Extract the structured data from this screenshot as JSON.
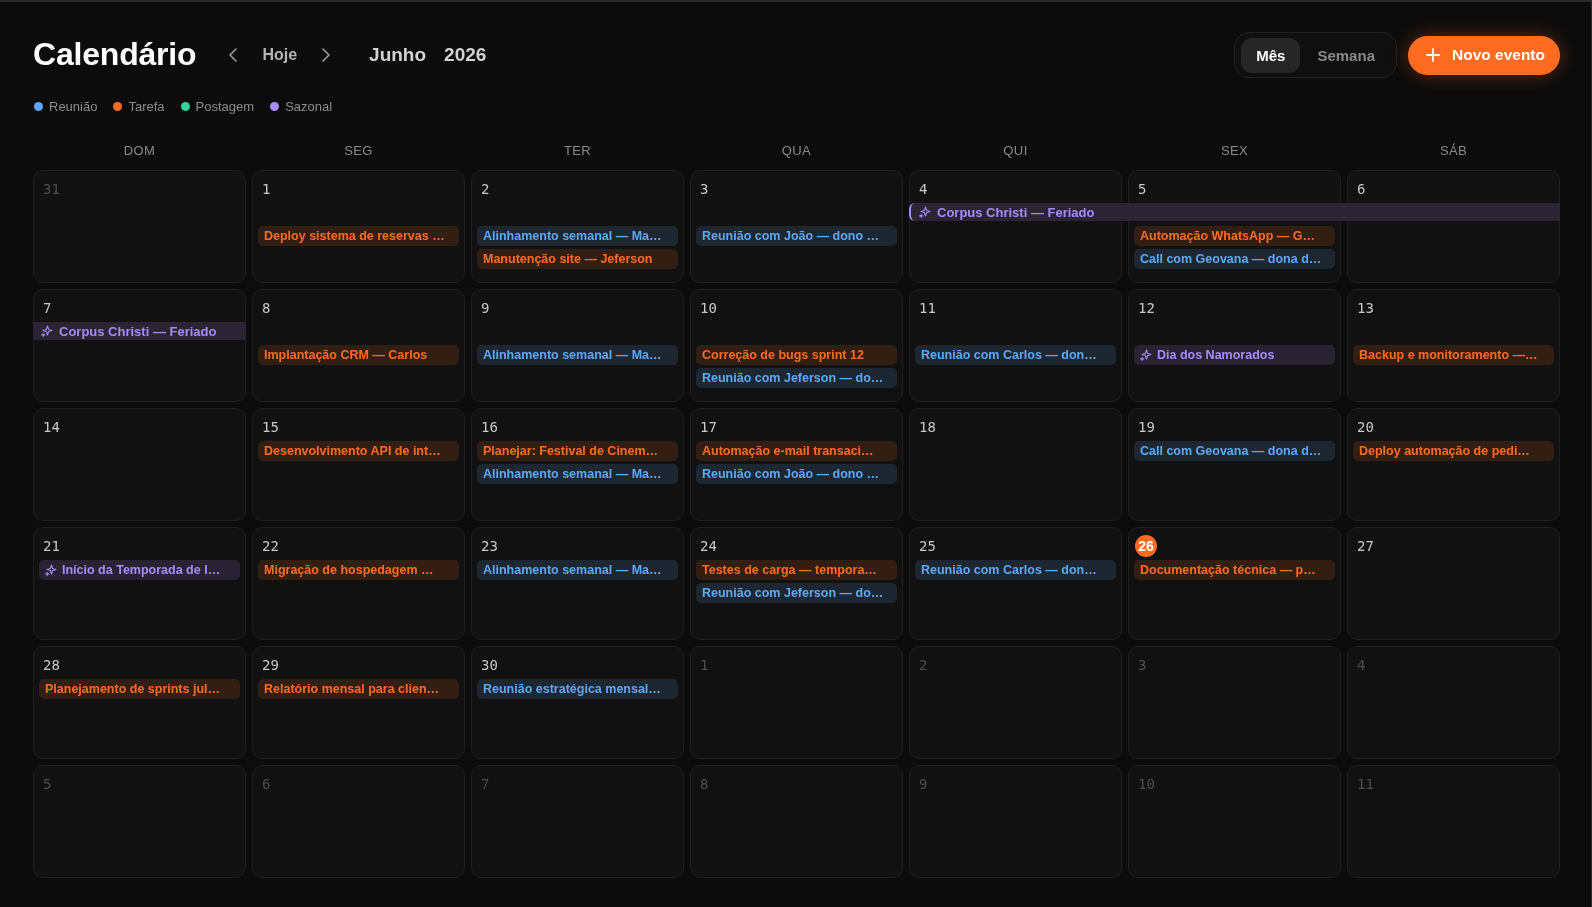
{
  "header": {
    "title": "Calendário",
    "today_button": "Hoje",
    "month": "Junho",
    "year": "2026",
    "view_tabs": [
      {
        "label": "Mês",
        "selected": true
      },
      {
        "label": "Semana",
        "selected": false
      }
    ],
    "new_event_button": "Novo evento"
  },
  "legend": [
    {
      "label": "Reunião",
      "color": "#5ea8f8"
    },
    {
      "label": "Tarefa",
      "color": "#ff6b21"
    },
    {
      "label": "Postagem",
      "color": "#34d39a"
    },
    {
      "label": "Sazonal",
      "color": "#a78bfa"
    }
  ],
  "weekdays": [
    "DOM",
    "SEG",
    "TER",
    "QUA",
    "QUI",
    "SEX",
    "SÁB"
  ],
  "weeks": [
    {
      "days": [
        {
          "number": "31",
          "in_month": false,
          "today": false
        },
        {
          "number": "1",
          "in_month": true,
          "today": false,
          "events": [
            {
              "label": "Deploy sistema de reservas …",
              "kind": "task"
            }
          ]
        },
        {
          "number": "2",
          "in_month": true,
          "today": false,
          "events": [
            {
              "label": "Alinhamento semanal — Ma…",
              "kind": "meeting"
            },
            {
              "label": "Manutenção site — Jeferson",
              "kind": "task"
            }
          ]
        },
        {
          "number": "3",
          "in_month": true,
          "today": false,
          "events": [
            {
              "label": "Reunião com João — dono …",
              "kind": "meeting"
            }
          ]
        },
        {
          "number": "4",
          "in_month": true,
          "today": false,
          "banner": {
            "label": "Corpus Christi — Feriado",
            "kind": "seasonal",
            "continued": false
          }
        },
        {
          "number": "5",
          "in_month": true,
          "today": false,
          "banner_continues": true,
          "events": [
            {
              "label": "Automação WhatsApp — G…",
              "kind": "task"
            },
            {
              "label": "Call com Geovana — dona d…",
              "kind": "meeting"
            }
          ]
        },
        {
          "number": "6",
          "in_month": true,
          "today": false,
          "banner_continues": true
        }
      ]
    },
    {
      "days": [
        {
          "number": "7",
          "in_month": true,
          "today": false,
          "banner": {
            "label": "Corpus Christi — Feriado",
            "kind": "seasonal",
            "continued": true
          }
        },
        {
          "number": "8",
          "in_month": true,
          "today": false,
          "events": [
            {
              "label": "Implantação CRM — Carlos",
              "kind": "task"
            }
          ]
        },
        {
          "number": "9",
          "in_month": true,
          "today": false,
          "events": [
            {
              "label": "Alinhamento semanal — Ma…",
              "kind": "meeting"
            }
          ]
        },
        {
          "number": "10",
          "in_month": true,
          "today": false,
          "events": [
            {
              "label": "Correção de bugs sprint 12",
              "kind": "task"
            },
            {
              "label": "Reunião com Jeferson — do…",
              "kind": "meeting"
            }
          ]
        },
        {
          "number": "11",
          "in_month": true,
          "today": false,
          "events": [
            {
              "label": "Reunião com Carlos — don…",
              "kind": "meeting"
            }
          ]
        },
        {
          "number": "12",
          "in_month": true,
          "today": false,
          "events": [
            {
              "label": "Dia dos Namorados",
              "kind": "seasonal"
            }
          ]
        },
        {
          "number": "13",
          "in_month": true,
          "today": false,
          "events": [
            {
              "label": "Backup e monitoramento —…",
              "kind": "task"
            }
          ]
        }
      ]
    },
    {
      "days": [
        {
          "number": "14",
          "in_month": true,
          "today": false
        },
        {
          "number": "15",
          "in_month": true,
          "today": false,
          "events": [
            {
              "label": "Desenvolvimento API de int…",
              "kind": "task"
            }
          ]
        },
        {
          "number": "16",
          "in_month": true,
          "today": false,
          "events": [
            {
              "label": "Planejar: Festival de Cinem…",
              "kind": "task"
            },
            {
              "label": "Alinhamento semanal — Ma…",
              "kind": "meeting"
            }
          ]
        },
        {
          "number": "17",
          "in_month": true,
          "today": false,
          "events": [
            {
              "label": "Automação e-mail transaci…",
              "kind": "task"
            },
            {
              "label": "Reunião com João — dono …",
              "kind": "meeting"
            }
          ]
        },
        {
          "number": "18",
          "in_month": true,
          "today": false
        },
        {
          "number": "19",
          "in_month": true,
          "today": false,
          "events": [
            {
              "label": "Call com Geovana — dona d…",
              "kind": "meeting"
            }
          ]
        },
        {
          "number": "20",
          "in_month": true,
          "today": false,
          "events": [
            {
              "label": "Deploy automação de pedi…",
              "kind": "task"
            }
          ]
        }
      ]
    },
    {
      "days": [
        {
          "number": "21",
          "in_month": true,
          "today": false,
          "events": [
            {
              "label": "Início da Temporada de I…",
              "kind": "seasonal"
            }
          ]
        },
        {
          "number": "22",
          "in_month": true,
          "today": false,
          "events": [
            {
              "label": "Migração de hospedagem …",
              "kind": "task"
            }
          ]
        },
        {
          "number": "23",
          "in_month": true,
          "today": false,
          "events": [
            {
              "label": "Alinhamento semanal — Ma…",
              "kind": "meeting"
            }
          ]
        },
        {
          "number": "24",
          "in_month": true,
          "today": false,
          "events": [
            {
              "label": "Testes de carga — tempora…",
              "kind": "task"
            },
            {
              "label": "Reunião com Jeferson — do…",
              "kind": "meeting"
            }
          ]
        },
        {
          "number": "25",
          "in_month": true,
          "today": false,
          "events": [
            {
              "label": "Reunião com Carlos — don…",
              "kind": "meeting"
            }
          ]
        },
        {
          "number": "26",
          "in_month": true,
          "today": true,
          "events": [
            {
              "label": "Documentação técnica — p…",
              "kind": "task"
            }
          ]
        },
        {
          "number": "27",
          "in_month": true,
          "today": false
        }
      ]
    },
    {
      "days": [
        {
          "number": "28",
          "in_month": true,
          "today": false,
          "events": [
            {
              "label": "Planejamento de sprints jul…",
              "kind": "task"
            }
          ]
        },
        {
          "number": "29",
          "in_month": true,
          "today": false,
          "events": [
            {
              "label": "Relatório mensal para clien…",
              "kind": "task"
            }
          ]
        },
        {
          "number": "30",
          "in_month": true,
          "today": false,
          "events": [
            {
              "label": "Reunião estratégica mensal…",
              "kind": "meeting"
            }
          ]
        },
        {
          "number": "1",
          "in_month": false,
          "today": false
        },
        {
          "number": "2",
          "in_month": false,
          "today": false
        },
        {
          "number": "3",
          "in_month": false,
          "today": false
        },
        {
          "number": "4",
          "in_month": false,
          "today": false
        }
      ]
    },
    {
      "days": [
        {
          "number": "5",
          "in_month": false,
          "today": false
        },
        {
          "number": "6",
          "in_month": false,
          "today": false
        },
        {
          "number": "7",
          "in_month": false,
          "today": false
        },
        {
          "number": "8",
          "in_month": false,
          "today": false
        },
        {
          "number": "9",
          "in_month": false,
          "today": false
        },
        {
          "number": "10",
          "in_month": false,
          "today": false
        },
        {
          "number": "11",
          "in_month": false,
          "today": false
        }
      ]
    }
  ]
}
